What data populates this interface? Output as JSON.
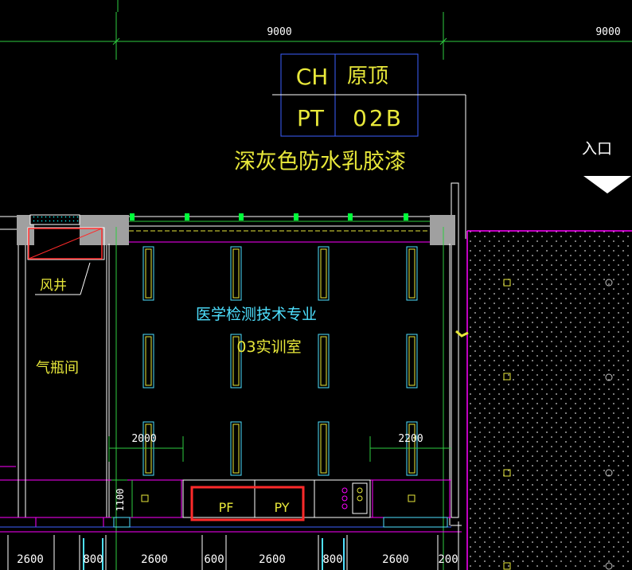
{
  "dimensions": {
    "top_left": "9000",
    "top_right": "9000",
    "left_clear": "2000",
    "right_clear": "2200",
    "cabinet_height": "1100",
    "bottom": [
      "2600",
      "800",
      "2600",
      "600",
      "2600",
      "800",
      "2600",
      "200"
    ]
  },
  "finish_table": {
    "ceiling_code": "CH",
    "ceiling_value": "原顶",
    "paint_code": "PT",
    "paint_value": "02B"
  },
  "finish_note": "深灰色防水乳胶漆",
  "entrance_label": "入口",
  "rooms": {
    "shaft": "风井",
    "gas_room": "气瓶间",
    "lab_line1": "医学检测技术专业",
    "lab_line2": "03实训室"
  },
  "equipment": {
    "pf": "PF",
    "py": "PY"
  },
  "colors": {
    "background": "#000000",
    "yellow_text": "#e8e83a",
    "cyan_text": "#4ee0ff",
    "wall_gray": "#a0a0a0",
    "magenta_line": "#ff00ff",
    "blue_line": "#3c5fff",
    "highlight_red": "#ff2a2a",
    "green_axis": "#2ecc40"
  }
}
